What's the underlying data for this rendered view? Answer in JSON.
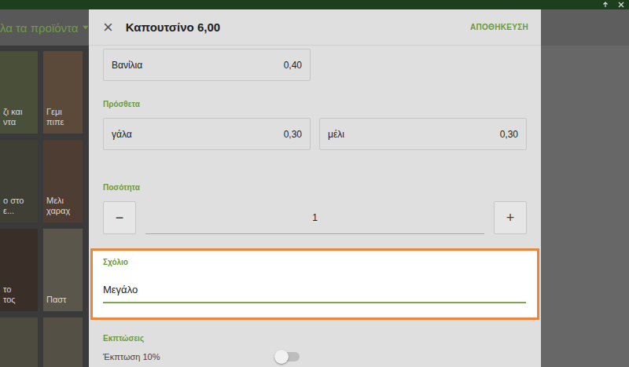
{
  "background": {
    "header_title": "λα τα προϊόντα",
    "tiles": [
      {
        "label": "ζι και\nντα"
      },
      {
        "label": "Γεμι\nπιπε"
      },
      {
        "label": "ο στο\nε..."
      },
      {
        "label": "Μελι\nχαραχ"
      },
      {
        "label": "το\nτος"
      },
      {
        "label": "Παστ"
      },
      {
        "label": ""
      },
      {
        "label": ""
      }
    ]
  },
  "dialog": {
    "close": "×",
    "title": "Καπουτσίνο 6,00",
    "save": "ΑΠΟΘΗΚΕΥΣΗ"
  },
  "options": [
    {
      "name": "Βανίλια",
      "price": "0,40"
    }
  ],
  "extras": {
    "label": "Πρόσθετα",
    "items": [
      {
        "name": "γάλα",
        "price": "0,30"
      },
      {
        "name": "μέλι",
        "price": "0,30"
      }
    ]
  },
  "quantity": {
    "label": "Ποσότητα",
    "minus": "−",
    "value": "1",
    "plus": "+"
  },
  "comment": {
    "label": "Σχόλιο",
    "value": "Μεγάλο",
    "highlighted": true
  },
  "discounts": {
    "label": "Εκπτώσεις",
    "items": [
      {
        "name": "Έκπτωση 10%",
        "on": false
      }
    ]
  }
}
